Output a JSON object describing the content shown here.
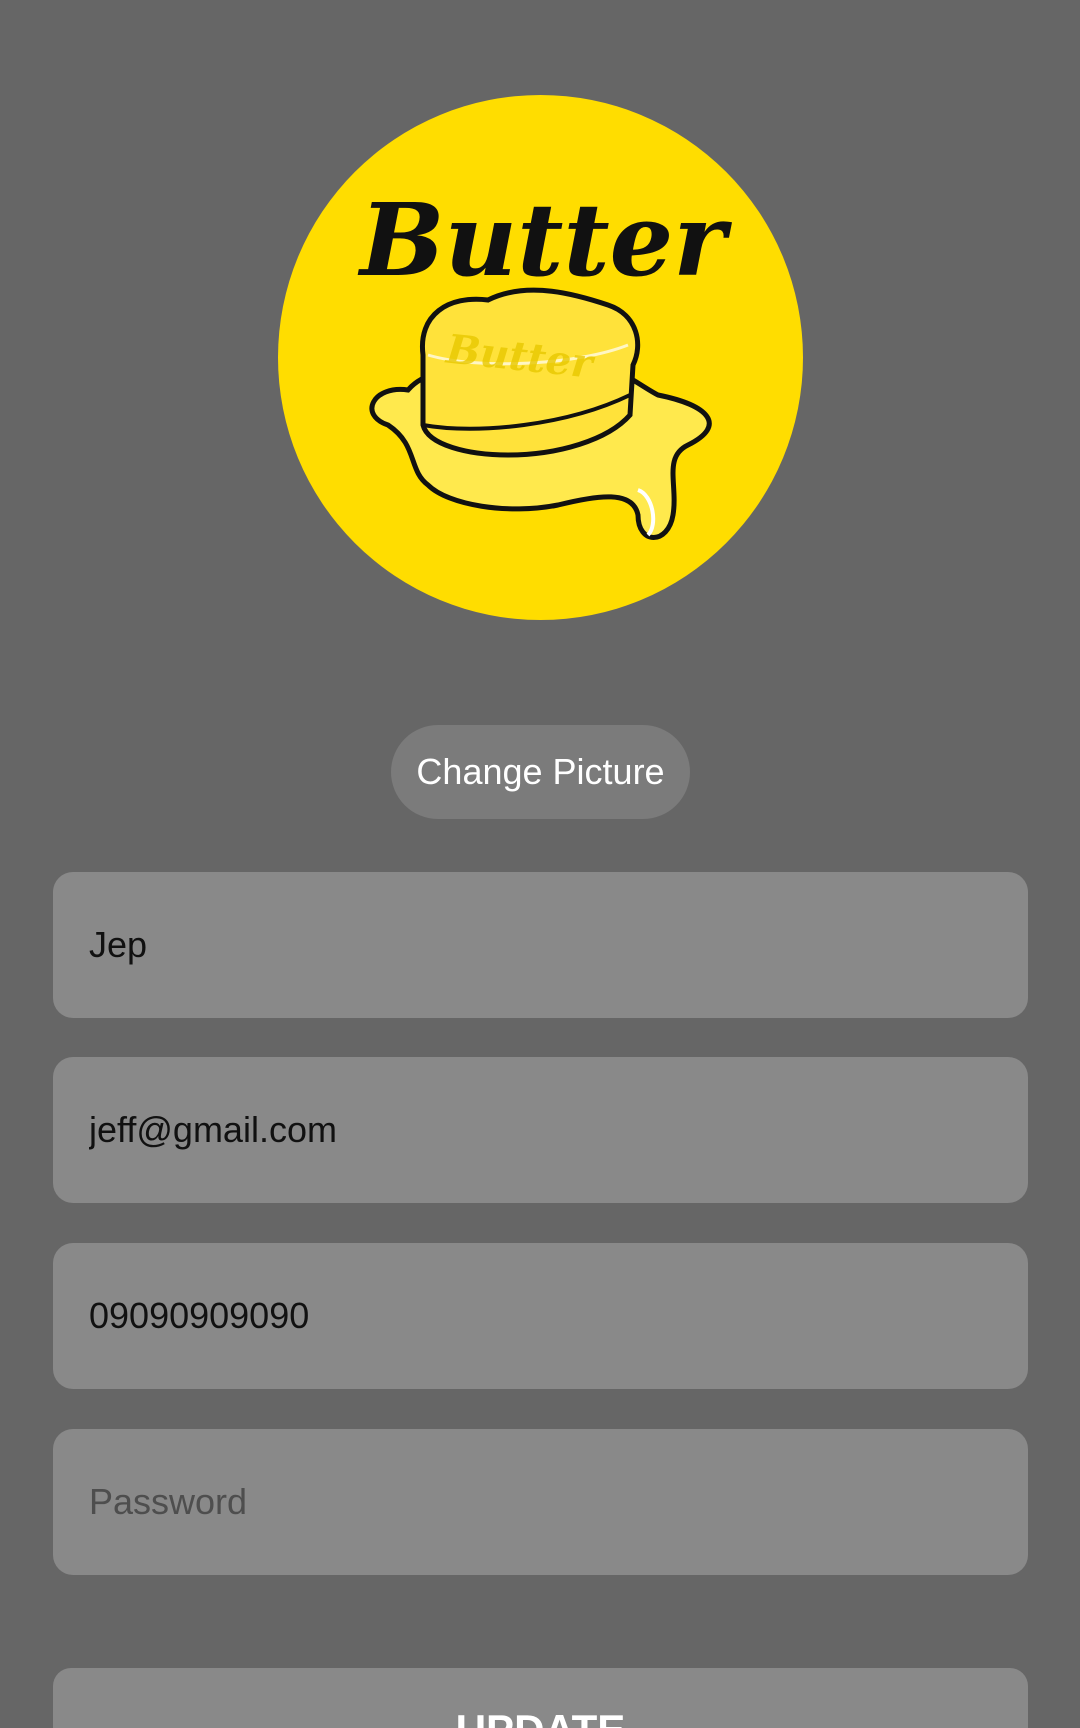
{
  "profile": {
    "avatar_logo_text": "Butter",
    "change_picture_label": "Change Picture"
  },
  "form": {
    "name_value": "Jep",
    "email_value": "jeff@gmail.com",
    "phone_value": "09090909090",
    "password_value": "",
    "password_placeholder": "Password",
    "update_label": "UPDATE"
  },
  "colors": {
    "background": "#666666",
    "field_bg": "#898989",
    "avatar_bg": "#FFDD00",
    "button_bg": "#7b7b7b"
  }
}
